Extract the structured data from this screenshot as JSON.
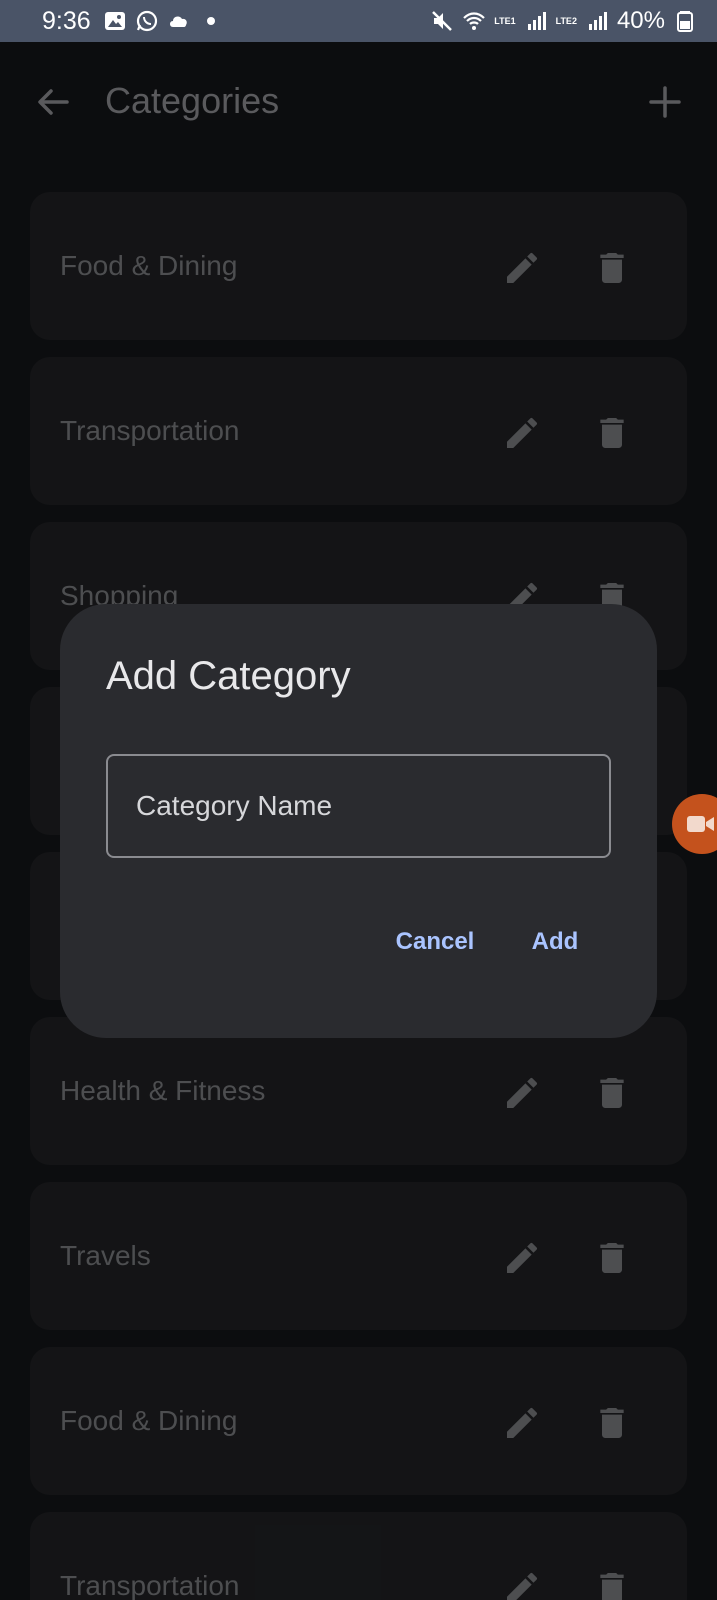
{
  "status_bar": {
    "time": "9:36",
    "battery": "40%",
    "sim1": "LTE1",
    "sim2": "LTE2"
  },
  "app_bar": {
    "title": "Categories"
  },
  "categories": [
    {
      "label": "Food & Dining"
    },
    {
      "label": "Transportation"
    },
    {
      "label": "Shopping"
    },
    {
      "label": ""
    },
    {
      "label": ""
    },
    {
      "label": "Health & Fitness"
    },
    {
      "label": "Travels"
    },
    {
      "label": "Food & Dining"
    },
    {
      "label": "Transportation"
    }
  ],
  "dialog": {
    "title": "Add Category",
    "input_placeholder": "Category Name",
    "input_value": "",
    "cancel_label": "Cancel",
    "add_label": "Add"
  },
  "colors": {
    "accent": "#aac4ff",
    "dialog_bg": "#2a2b2f",
    "card_bg": "#1f2023",
    "status_bar_bg": "#4a5467",
    "bubble": "#c4521d"
  }
}
